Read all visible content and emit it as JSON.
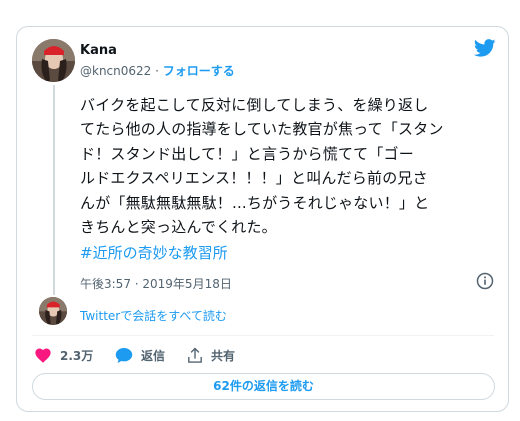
{
  "tweet": {
    "author_name": "Kana",
    "handle": "@kncn0622",
    "separator": " · ",
    "follow_label": "フォローする",
    "text": "バイクを起こして反対に倒してしまう、を繰り返し\nてたら他の人の指導をしていた教官が焦って「スタン\nド！スタンド出して！」と言うから慌てて「ゴー\nルドエクスペリエンス！！！」と叫んだら前の兄さ\nんが「無駄無駄無駄！...ちがうそれじゃない！」と\nきちんと突っ込んでくれた。",
    "hashtag": "#近所の奇妙な教習所",
    "timestamp": "午後3:57 · 2019年5月18日",
    "read_conversation": "Twitterで会話をすべて読む"
  },
  "actions": {
    "like_count": "2.3万",
    "reply_label": "返信",
    "share_label": "共有"
  },
  "replies_button": "62件の返信を読む",
  "colors": {
    "brand_blue": "#1d9bf0",
    "like_pink": "#f91880",
    "text_primary": "#0f1419",
    "text_secondary": "#536471",
    "border": "#cfd9de"
  },
  "icons": {
    "brand": "twitter-bird-icon",
    "info": "info-icon",
    "like": "heart-icon",
    "reply": "speech-bubble-icon",
    "share": "share-upload-icon"
  }
}
